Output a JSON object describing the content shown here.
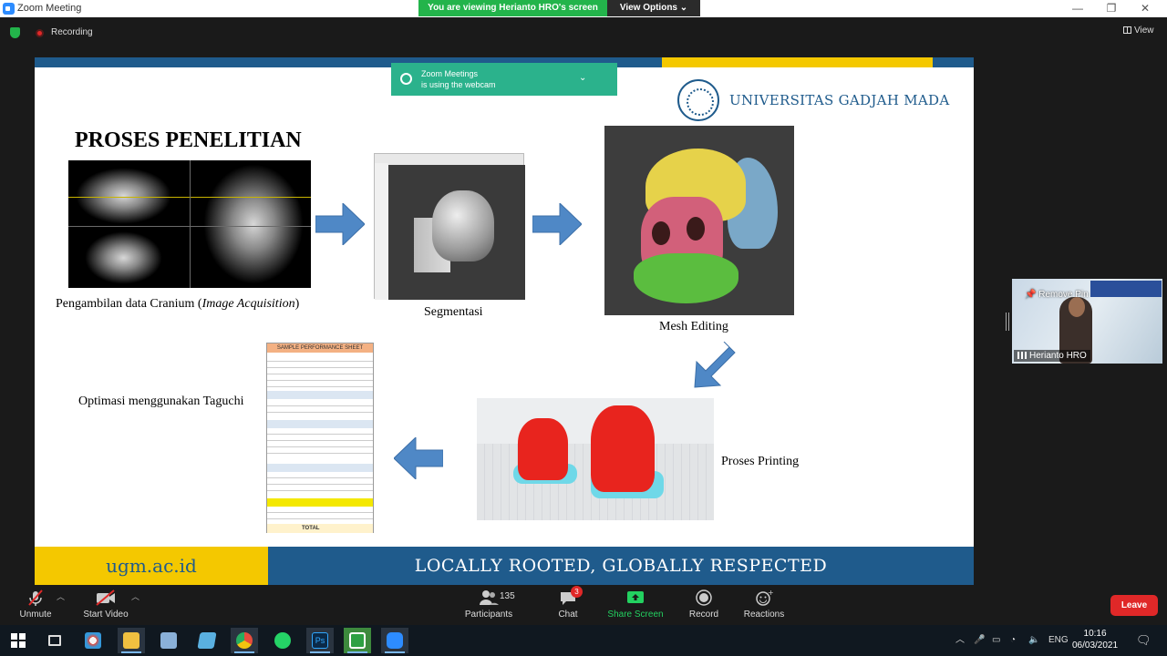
{
  "window": {
    "title": "Zoom Meeting",
    "minimize": "—",
    "maximize": "❐",
    "close": "✕"
  },
  "banner": {
    "viewing": "You are viewing Herianto HRO's screen",
    "view_options": "View Options ⌄"
  },
  "status": {
    "recording": "Recording",
    "view": "View"
  },
  "notification": {
    "line1": "Zoom Meetings",
    "line2": "is using the webcam",
    "chevron": "⌄"
  },
  "slide": {
    "university": "UNIVERSITAS GADJAH MADA",
    "title": "PROSES PENELITIAN",
    "caption_acquisition_prefix": "Pengambilan data Cranium (",
    "caption_acquisition_italic": "Image Acquisition",
    "caption_acquisition_suffix": ")",
    "caption_segmentasi": "Segmentasi",
    "caption_mesh": "Mesh Editing",
    "caption_printing": "Proses Printing",
    "caption_taguchi": "Optimasi menggunakan Taguchi",
    "sheet_title": "SAMPLE PERFORMANCE SHEET",
    "sheet_total": "TOTAL",
    "footer_site": "ugm.ac.id",
    "footer_motto": "LOCALLY ROOTED, GLOBALLY RESPECTED"
  },
  "participant": {
    "name": "Herianto HRO",
    "remove_pin": "Remove Pin"
  },
  "controls": {
    "unmute": "Unmute",
    "start_video": "Start Video",
    "participants": "Participants",
    "participants_count": "135",
    "chat": "Chat",
    "chat_badge": "3",
    "share_screen": "Share Screen",
    "record": "Record",
    "reactions": "Reactions",
    "leave": "Leave"
  },
  "taskbar": {
    "language": "ENG",
    "time": "10:16",
    "date": "06/03/2021"
  },
  "colors": {
    "ugm_blue": "#1f5b8c",
    "ugm_yellow": "#f4c800",
    "zoom_green": "#23b44b",
    "leave_red": "#e02828",
    "share_green": "#23d160"
  }
}
